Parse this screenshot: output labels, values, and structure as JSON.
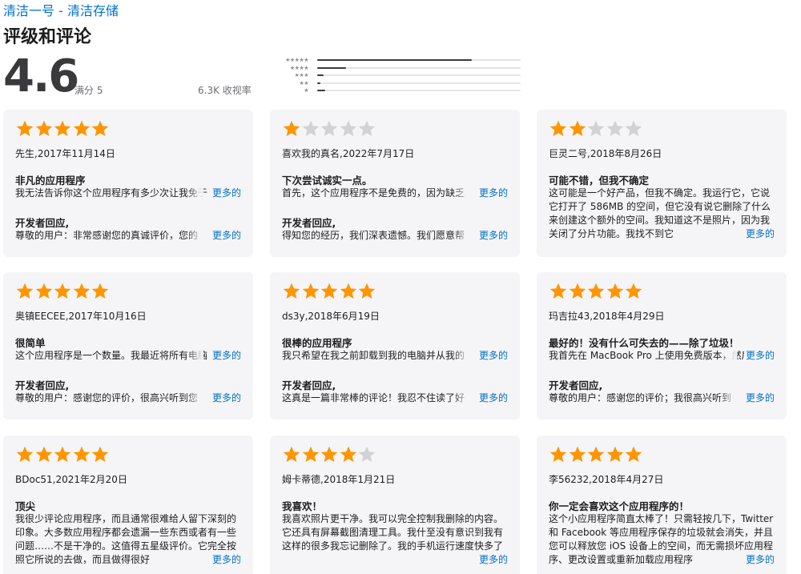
{
  "header": {
    "breadcrumb": "清洁一号 - 清洁存储",
    "title": "评级和评论"
  },
  "summary": {
    "score": "4.6",
    "out_of": "满分 5",
    "count": "6.3K 收视率"
  },
  "histogram": [
    {
      "stars_label": "★★★★★",
      "fraction": 0.76
    },
    {
      "stars_label": "★★★★",
      "fraction": 0.14
    },
    {
      "stars_label": "★★★",
      "fraction": 0.03
    },
    {
      "stars_label": "★★",
      "fraction": 0.01
    },
    {
      "stars_label": "★",
      "fraction": 0.04
    }
  ],
  "more_label": "更多的",
  "developer_response_label": "开发者回应,",
  "colors": {
    "star_on": "#ff9500",
    "star_off": "#d1d1d6",
    "link": "#0070c9",
    "card_bg": "#f5f5f7"
  },
  "reviews": [
    {
      "rating": 5,
      "author_date": "先生,2017年11月14日",
      "title": "非凡的应用程序",
      "body": "我无法告诉你这个应用程序有多少次让我免于",
      "response": "尊敬的用户：非常感谢您的真诚评价，您的"
    },
    {
      "rating": 1,
      "author_date": "喜欢我的真名,2022年7月17日",
      "title": "下次尝试诚实一点。",
      "body": "首先，这个应用程序不是免费的，因为缺乏",
      "response": "得知您的经历，我们深表遗憾。我们愿意帮"
    },
    {
      "rating": 2,
      "author_date": "巨灵二号,2018年8月26日",
      "title": "可能不错，但我不确定",
      "body": "这可能是一个好产品，但我不确定。我运行它，它说它打开了 586MB 的空间，但它没有说它删除了什么来创建这个额外的空间。我知道这不是照片，因为我关闭了分片功能。我找不到它",
      "response": null
    },
    {
      "rating": 5,
      "author_date": "奥镇EECEE,2017年10月16日",
      "title": "很简单",
      "body": "这个应用程序是一个数量。我最近将所有电脑",
      "response": "尊敬的用户：感谢您的评价，很高兴听到您"
    },
    {
      "rating": 5,
      "author_date": "ds3y,2018年6月19日",
      "title": "很棒的应用程序",
      "body": "我只希望在我之前卸载到我的电脑并从我的",
      "response": "这真是一篇非常棒的评论！我忍不住读了好"
    },
    {
      "rating": 5,
      "author_date": "玛吉拉43,2018年4月29日",
      "title": "最好的！没有什么可失去的——除了垃圾！",
      "body": "我首先在 MacBook Pro 上使用免费版本，然后",
      "response": "尊敬的用户：感谢您的评价；我很高兴听到"
    },
    {
      "rating": 5,
      "author_date": "BDoc51,2021年2月20日",
      "title": "顶尖",
      "body": "我很少评论应用程序，而且通常很难给人留下深刻的印象。大多数应用程序都会遗漏一些东西或者有一些问题……不是干净的。这值得五星级评价。它完全按照它所说的去做，而且做得很好",
      "response": null
    },
    {
      "rating": 4,
      "author_date": "姆卡蒂德,2018年1月21日",
      "title": "我喜欢！",
      "body": "我喜欢照片更干净。我可以完全控制我删除的内容。它还具有屏幕截图清理工具。我什至没有意识到我有这样的很多我忘记删除了。我的手机运行速度快多了",
      "response": null
    },
    {
      "rating": 5,
      "author_date": "李56232,2018年4月27日",
      "title": "你一定会喜欢这个应用程序的！",
      "body": "这个小应用程序简直太棒了！只需轻按几下，Twitter 和 Facebook 等应用程序保存的垃圾就会消失，并且您可以释放您 iOS 设备上的空间，而无需损坏应用程序、更改设置或重新加载应用程序",
      "response": null
    }
  ]
}
